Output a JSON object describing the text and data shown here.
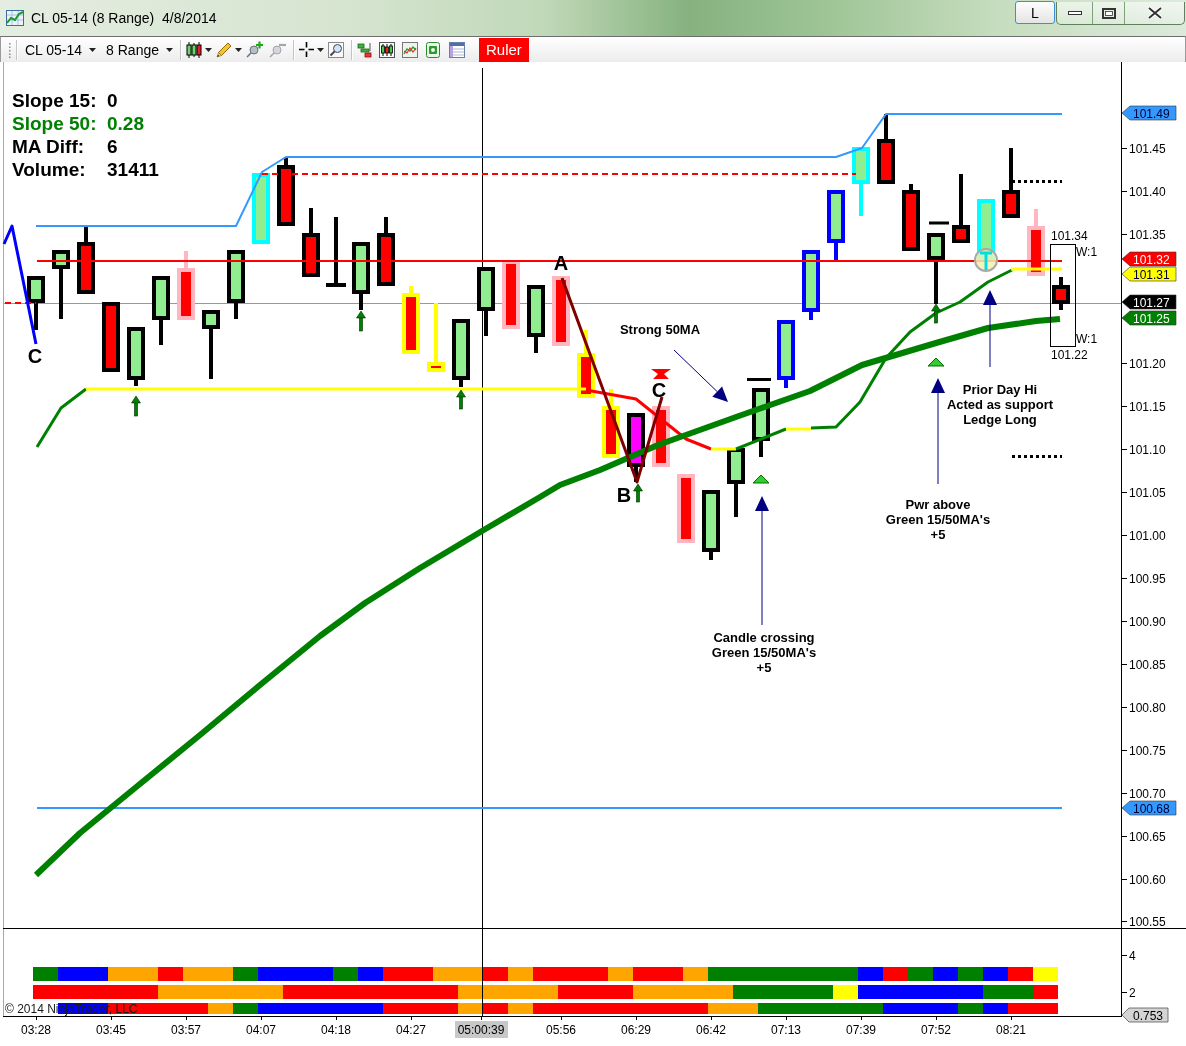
{
  "window": {
    "title": "CL 05-14 (8 Range)  4/8/2014",
    "buttons": [
      "L"
    ]
  },
  "toolbar": {
    "instrument": "CL 05-14",
    "period": "8 Range",
    "ruler": {
      "label": "Ruler",
      "active": true
    }
  },
  "chart": {
    "stats": [
      {
        "label": "Slope 15:",
        "value": "0",
        "color": "#000000"
      },
      {
        "label": "Slope 50:",
        "value": "0.28",
        "color": "#008000"
      },
      {
        "label": "MA Diff:",
        "value": "6",
        "color": "#000000"
      },
      {
        "label": "Volume:",
        "value": "31411",
        "color": "#000000"
      }
    ],
    "annotations": [
      {
        "kind": "letter",
        "text": "C"
      },
      {
        "kind": "letter",
        "text": "A"
      },
      {
        "kind": "letter",
        "text": "B"
      },
      {
        "kind": "letter",
        "text": "C"
      },
      {
        "kind": "note",
        "lines": [
          "Strong 50MA"
        ]
      },
      {
        "kind": "note",
        "lines": [
          "Candle crossing",
          "Green 15/50MA's",
          "+5"
        ]
      },
      {
        "kind": "note",
        "lines": [
          "Pwr above",
          "Green 15/50MA's",
          "+5"
        ]
      },
      {
        "kind": "note",
        "lines": [
          "Prior Day Hi",
          "Acted as support",
          "Ledge Long"
        ]
      }
    ],
    "range_box": {
      "high": "101.34",
      "upper_width": "W:1",
      "lower_width": "W:1",
      "low": "101.22"
    }
  },
  "price_axis": {
    "ticks": [
      "101.45",
      "101.40",
      "101.35",
      "101.20",
      "101.15",
      "101.10",
      "101.05",
      "101.00",
      "100.95",
      "100.90",
      "100.85",
      "100.80",
      "100.75",
      "100.70",
      "100.65",
      "100.60",
      "100.55"
    ],
    "tags": [
      {
        "label": "101.49",
        "color": "#3399ff"
      },
      {
        "label": "101.32",
        "color": "#ff0000"
      },
      {
        "label": "101.31",
        "color": "#ffff00"
      },
      {
        "label": "101.27",
        "color": "#000000"
      },
      {
        "label": "101.25",
        "color": "#008000"
      },
      {
        "label": "100.68",
        "color": "#3399ff"
      }
    ]
  },
  "indicator_axis": {
    "ticks": [
      "4",
      "2"
    ],
    "tag": "0.753"
  },
  "time_axis": {
    "labels": [
      {
        "label": "03:28",
        "selected": false
      },
      {
        "label": "03:45",
        "selected": false
      },
      {
        "label": "03:57",
        "selected": false
      },
      {
        "label": "04:07",
        "selected": false
      },
      {
        "label": "04:18",
        "selected": false
      },
      {
        "label": "04:27",
        "selected": false
      },
      {
        "label": "05:00:39",
        "selected": true
      },
      {
        "label": "05:56",
        "selected": false
      },
      {
        "label": "06:29",
        "selected": false
      },
      {
        "label": "06:42",
        "selected": false
      },
      {
        "label": "07:13",
        "selected": false
      },
      {
        "label": "07:39",
        "selected": false
      },
      {
        "label": "07:52",
        "selected": false
      },
      {
        "label": "08:21",
        "selected": false
      }
    ]
  },
  "copyright": "© 2014 NinjaTrader, LLC"
}
